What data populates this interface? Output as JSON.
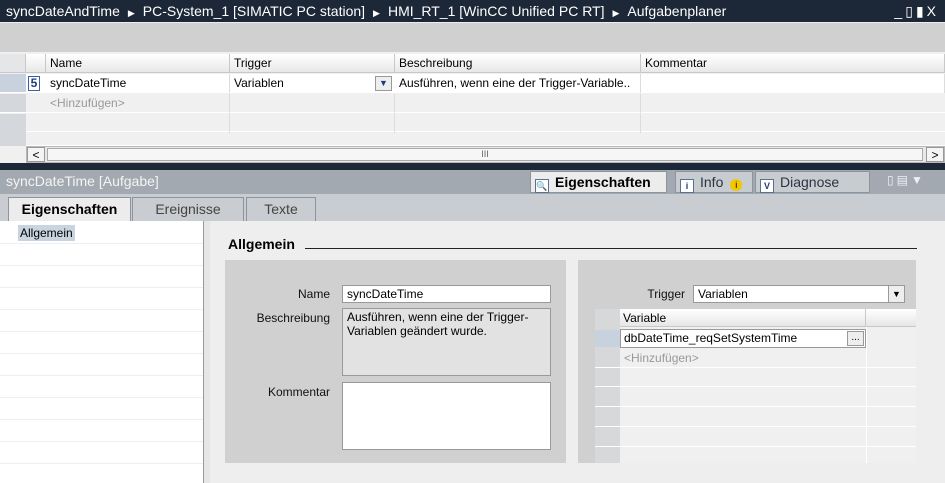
{
  "breadcrumb": [
    "syncDateAndTime",
    "PC-System_1 [SIMATIC PC station]",
    "HMI_RT_1 [WinCC Unified PC RT]",
    "Aufgabenplaner"
  ],
  "window_controls": {
    "minimize": "_",
    "restore": "▯",
    "maximize": "▮",
    "close": "X"
  },
  "table": {
    "columns": [
      "Name",
      "Trigger",
      "Beschreibung",
      "Kommentar"
    ],
    "rows": [
      {
        "index": "5",
        "name": "syncDateTime",
        "trigger": "Variablen",
        "beschreibung": "Ausführen, wenn eine der Trigger-Variable..",
        "kommentar": ""
      }
    ],
    "add_placeholder": "<Hinzufügen>",
    "scroll_left": "<",
    "scroll_right": ">",
    "scroll_thumb": "III"
  },
  "inspector": {
    "title": "syncDateTime [Aufgabe]",
    "tabs": [
      {
        "label": "Eigenschaften",
        "icon": "properties-icon"
      },
      {
        "label": "Info",
        "icon": "info-icon"
      },
      {
        "label": "Diagnose",
        "icon": "diagnose-icon"
      }
    ],
    "subtabs": [
      "Eigenschaften",
      "Ereignisse",
      "Texte"
    ],
    "nav": [
      "Allgemein"
    ],
    "section": "Allgemein",
    "form": {
      "name_label": "Name",
      "name_value": "syncDateTime",
      "beschreibung_label": "Beschreibung",
      "beschreibung_value": "Ausführen, wenn eine der Trigger-Variablen geändert wurde.",
      "kommentar_label": "Kommentar",
      "kommentar_value": "",
      "trigger_label": "Trigger",
      "trigger_value": "Variablen",
      "variable_header": "Variable",
      "variables": [
        "dbDateTime_reqSetSystemTime"
      ],
      "browse_label": "...",
      "add_placeholder": "<Hinzufügen>"
    }
  }
}
